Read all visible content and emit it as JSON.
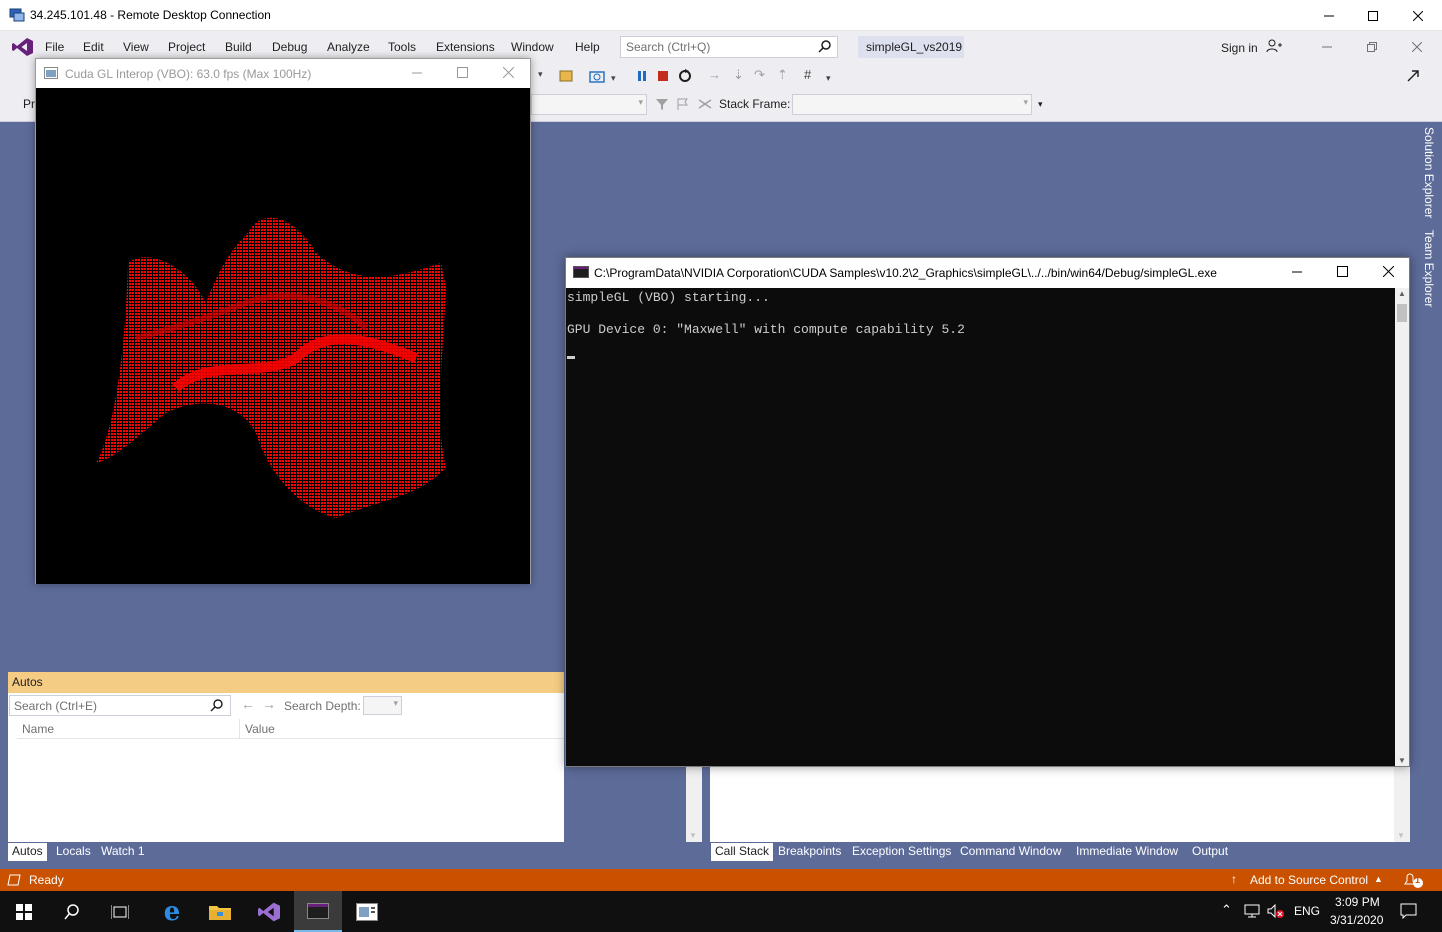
{
  "rdp": {
    "title": "34.245.101.48 - Remote Desktop Connection"
  },
  "vs": {
    "menu": [
      "File",
      "Edit",
      "View",
      "Project",
      "Build",
      "Debug",
      "Analyze",
      "Tools",
      "Extensions",
      "Window",
      "Help"
    ],
    "search_placeholder": "Search (Ctrl+Q)",
    "solution_name": "simpleGL_vs2019",
    "sign_in": "Sign in",
    "stack_frame_label": "Stack Frame:",
    "toolbar2_left_text": "Pr",
    "side_tabs": [
      "Solution Explorer",
      "Team Explorer"
    ]
  },
  "gl_window": {
    "title": "Cuda GL Interop (VBO): 63.0 fps (Max 100Hz)",
    "mesh_color": "#ff0000"
  },
  "console": {
    "title": "C:\\ProgramData\\NVIDIA Corporation\\CUDA Samples\\v10.2\\2_Graphics\\simpleGL\\../../bin/win64/Debug/simpleGL.exe",
    "lines": [
      "simpleGL (VBO) starting...",
      "",
      "GPU Device 0: \"Maxwell\" with compute capability 5.2"
    ]
  },
  "autos": {
    "header": "Autos",
    "search_placeholder": "Search (Ctrl+E)",
    "search_depth_label": "Search Depth:",
    "columns": [
      "Name",
      "Value"
    ],
    "tabs": [
      "Autos",
      "Locals",
      "Watch 1"
    ]
  },
  "debug_tabs": [
    "Call Stack",
    "Breakpoints",
    "Exception Settings",
    "Command Window",
    "Immediate Window",
    "Output"
  ],
  "status": {
    "ready": "Ready",
    "source_control": "Add to Source Control",
    "notification_count": "1"
  },
  "taskbar": {
    "lang": "ENG",
    "time": "3:09 PM",
    "date": "3/31/2020",
    "apps": [
      "start-icon",
      "search-icon",
      "task-view-icon",
      "edge-icon",
      "file-explorer-icon",
      "visual-studio-icon",
      "console-app-icon",
      "gl-app-icon"
    ]
  },
  "colors": {
    "vs_accent": "#68217a",
    "workspace_bg": "#5d6b99",
    "status_bar": "#ca5100",
    "autos_header": "#f5cc84"
  }
}
